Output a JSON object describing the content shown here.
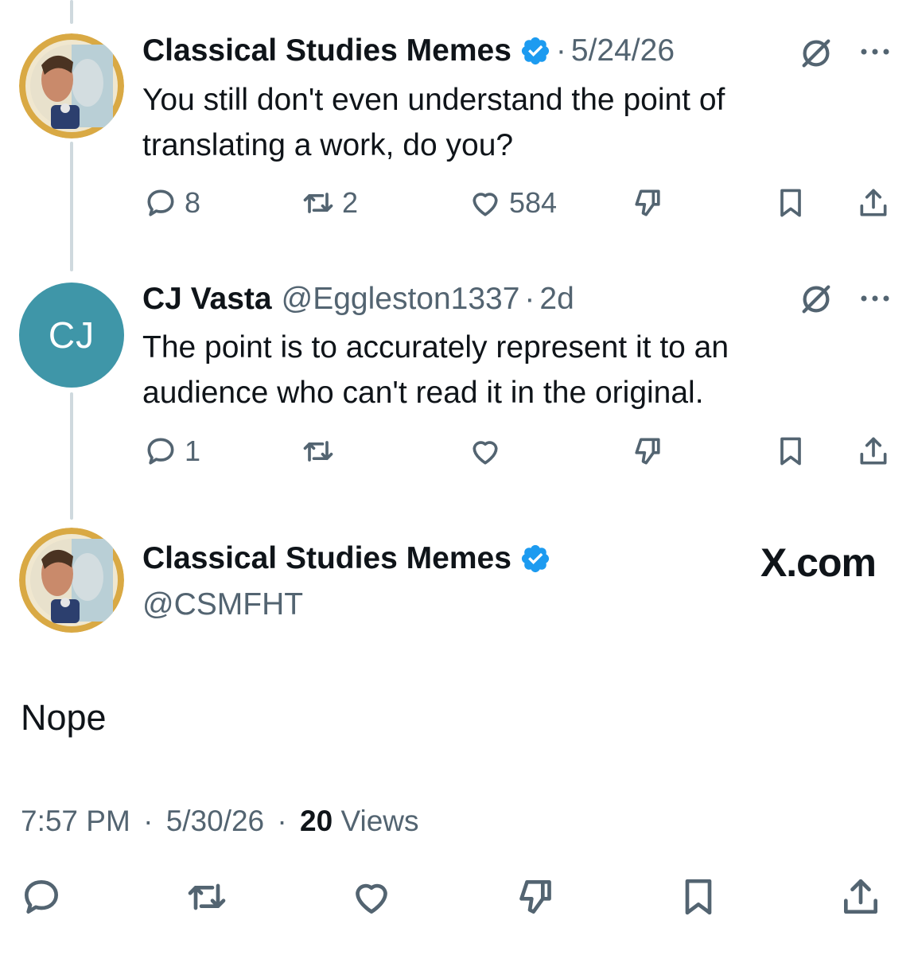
{
  "colors": {
    "accent": "#1d9bf0",
    "muted": "#536471",
    "text": "#0f1419",
    "thread_line": "#cfd9de",
    "cj_avatar": "#3f96a8"
  },
  "reply_1": {
    "author_name": "Classical Studies Memes",
    "separator": "·",
    "date": "5/24/26",
    "text": "You still don't even understand the point of translating a work, do you?",
    "replies": "8",
    "reposts": "2",
    "likes": "584",
    "icons": [
      "grok-icon",
      "more-icon",
      "reply-icon",
      "repost-icon",
      "like-icon",
      "dislike-icon",
      "bookmark-icon",
      "share-icon"
    ]
  },
  "reply_2": {
    "avatar_initials": "CJ",
    "author_name": "CJ Vasta",
    "handle": "@Eggleston1337",
    "separator": "·",
    "time": "2d",
    "text": "The point is to accurately represent it to an audience who can't read it in the original.",
    "replies": "1"
  },
  "main_tweet": {
    "author_name": "Classical Studies Memes",
    "handle": "@CSMFHT",
    "brand": "X.com",
    "text": "Nope",
    "time": "7:57 PM",
    "separator": "·",
    "date": "5/30/26",
    "views_count": "20",
    "views_label": "Views"
  }
}
